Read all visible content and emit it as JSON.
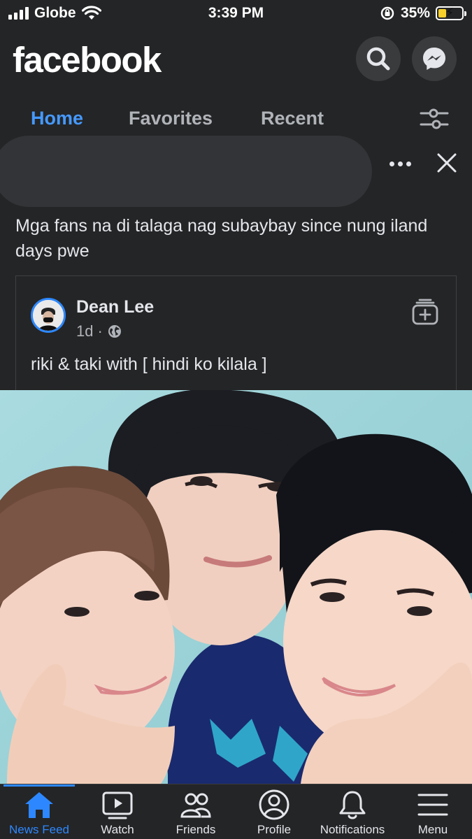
{
  "status_bar": {
    "carrier": "Globe",
    "time": "3:39 PM",
    "battery": "35%",
    "battery_level": 0.35
  },
  "header": {
    "logo": "facebook",
    "icons": [
      "search-icon",
      "messenger-icon"
    ]
  },
  "tabs": {
    "home": "Home",
    "favorites": "Favorites",
    "recent": "Recent",
    "active": "Home"
  },
  "post": {
    "caption": "Mga fans na di talaga nag subaybay since nung iland days pwe",
    "shared": {
      "author": "Dean Lee",
      "time": "1d",
      "separator": "·",
      "text": "riki & taki with [ hindi ko kilala ]"
    }
  },
  "bottom_nav": {
    "items": [
      {
        "label": "News Feed",
        "icon": "home-icon"
      },
      {
        "label": "Watch",
        "icon": "play-icon"
      },
      {
        "label": "Friends",
        "icon": "friends-icon"
      },
      {
        "label": "Profile",
        "icon": "profile-icon"
      },
      {
        "label": "Notifications",
        "icon": "bell-icon"
      },
      {
        "label": "Menu",
        "icon": "hamburger-icon"
      }
    ],
    "active": "News Feed"
  },
  "colors": {
    "background": "#242526",
    "accent": "#2d88ff",
    "text": "#e4e6eb",
    "muted": "#b0b3b8"
  }
}
